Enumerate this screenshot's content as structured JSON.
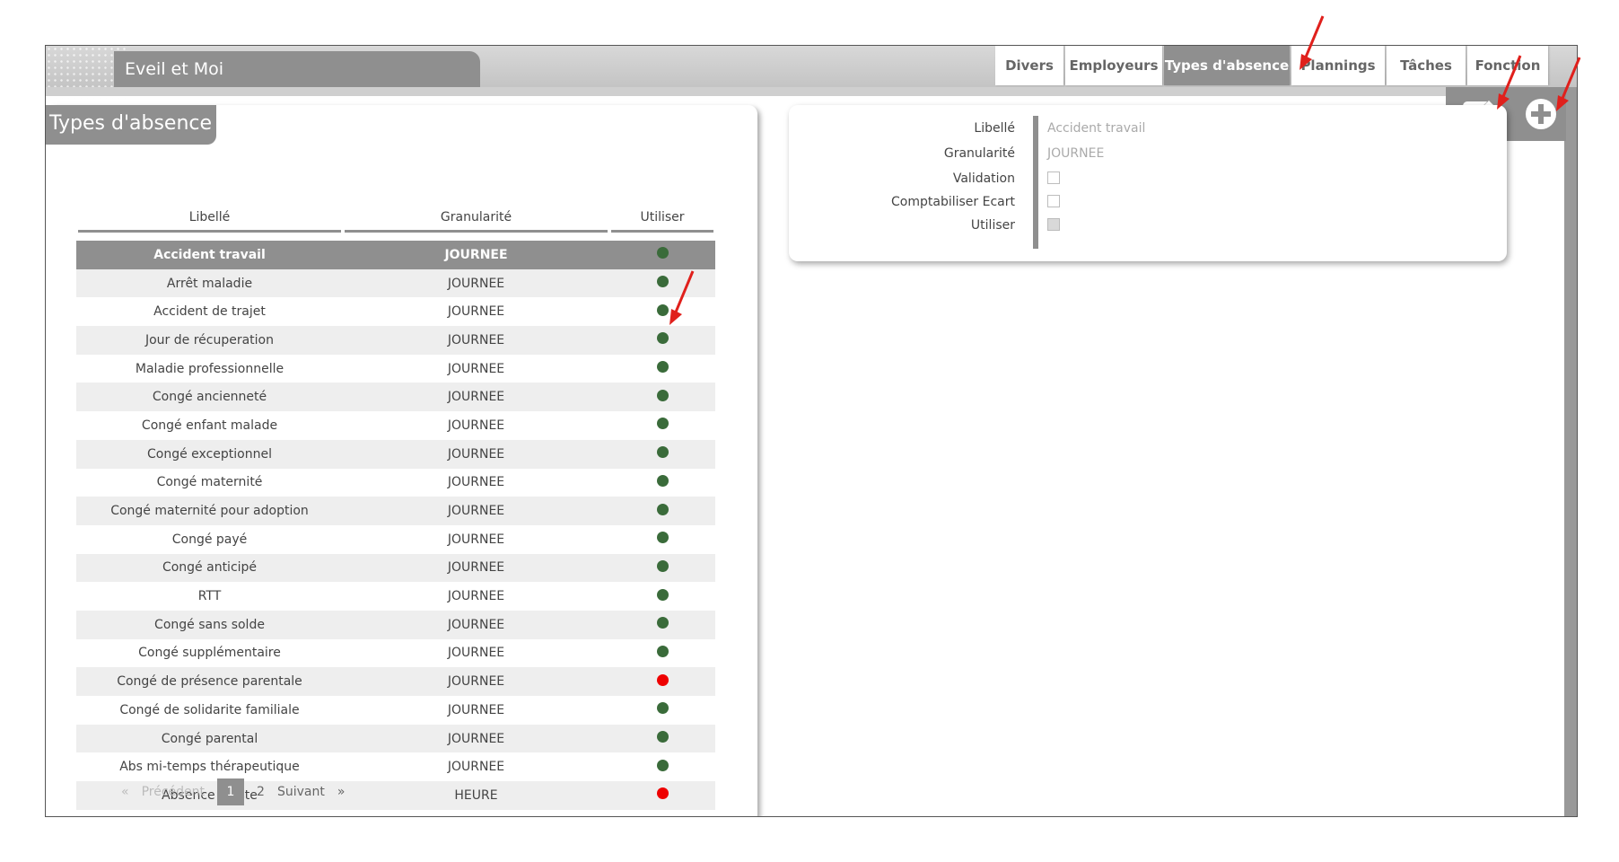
{
  "app": {
    "title": "Eveil et Moi"
  },
  "tabs": [
    {
      "label": "Divers",
      "active": false
    },
    {
      "label": "Employeurs",
      "active": false
    },
    {
      "label": "Types d'absence",
      "active": true
    },
    {
      "label": "Plannings",
      "active": false
    },
    {
      "label": "Tâches",
      "active": false
    },
    {
      "label": "Fonction",
      "active": false
    }
  ],
  "actions": {
    "edit_icon": "edit-icon",
    "add_icon": "add-circle-icon"
  },
  "section": {
    "title": "Types d'absence"
  },
  "table": {
    "headers": {
      "libelle": "Libellé",
      "granularite": "Granularité",
      "utiliser": "Utiliser"
    },
    "rows": [
      {
        "libelle": "Accident travail",
        "granularite": "JOURNEE",
        "status": "green",
        "selected": true
      },
      {
        "libelle": "Arrêt maladie",
        "granularite": "JOURNEE",
        "status": "green"
      },
      {
        "libelle": "Accident de trajet",
        "granularite": "JOURNEE",
        "status": "green"
      },
      {
        "libelle": "Jour de récuperation",
        "granularite": "JOURNEE",
        "status": "green"
      },
      {
        "libelle": "Maladie professionnelle",
        "granularite": "JOURNEE",
        "status": "green"
      },
      {
        "libelle": "Congé ancienneté",
        "granularite": "JOURNEE",
        "status": "green"
      },
      {
        "libelle": "Congé enfant malade",
        "granularite": "JOURNEE",
        "status": "green"
      },
      {
        "libelle": "Congé exceptionnel",
        "granularite": "JOURNEE",
        "status": "green"
      },
      {
        "libelle": "Congé maternité",
        "granularite": "JOURNEE",
        "status": "green"
      },
      {
        "libelle": "Congé maternité pour adoption",
        "granularite": "JOURNEE",
        "status": "green"
      },
      {
        "libelle": "Congé payé",
        "granularite": "JOURNEE",
        "status": "green"
      },
      {
        "libelle": "Congé anticipé",
        "granularite": "JOURNEE",
        "status": "green"
      },
      {
        "libelle": "RTT",
        "granularite": "JOURNEE",
        "status": "green"
      },
      {
        "libelle": "Congé sans solde",
        "granularite": "JOURNEE",
        "status": "green"
      },
      {
        "libelle": "Congé supplémentaire",
        "granularite": "JOURNEE",
        "status": "green"
      },
      {
        "libelle": "Congé de présence parentale",
        "granularite": "JOURNEE",
        "status": "red"
      },
      {
        "libelle": "Congé de solidarite familiale",
        "granularite": "JOURNEE",
        "status": "green"
      },
      {
        "libelle": "Congé parental",
        "granularite": "JOURNEE",
        "status": "green"
      },
      {
        "libelle": "Abs mi-temps thérapeutique",
        "granularite": "JOURNEE",
        "status": "green"
      },
      {
        "libelle": "Absence Sieste",
        "granularite": "HEURE",
        "status": "red"
      }
    ]
  },
  "pagination": {
    "prev_symbol": "«",
    "prev_label": "Précédent",
    "pages": [
      "1",
      "2"
    ],
    "current": "1",
    "next_label": "Suivant",
    "next_symbol": "»"
  },
  "detail": {
    "libelle_label": "Libellé",
    "libelle_value": "Accident travail",
    "granularite_label": "Granularité",
    "granularite_value": "JOURNEE",
    "validation_label": "Validation",
    "validation_checked": false,
    "comptabiliser_label": "Comptabiliser Ecart",
    "comptabiliser_checked": false,
    "utiliser_label": "Utiliser",
    "utiliser_checked": false
  },
  "colors": {
    "accent_gray": "#8f8f8f",
    "status_green": "#3a6b3a",
    "status_red": "#ee0000",
    "annotation_arrow": "#e0201c"
  }
}
